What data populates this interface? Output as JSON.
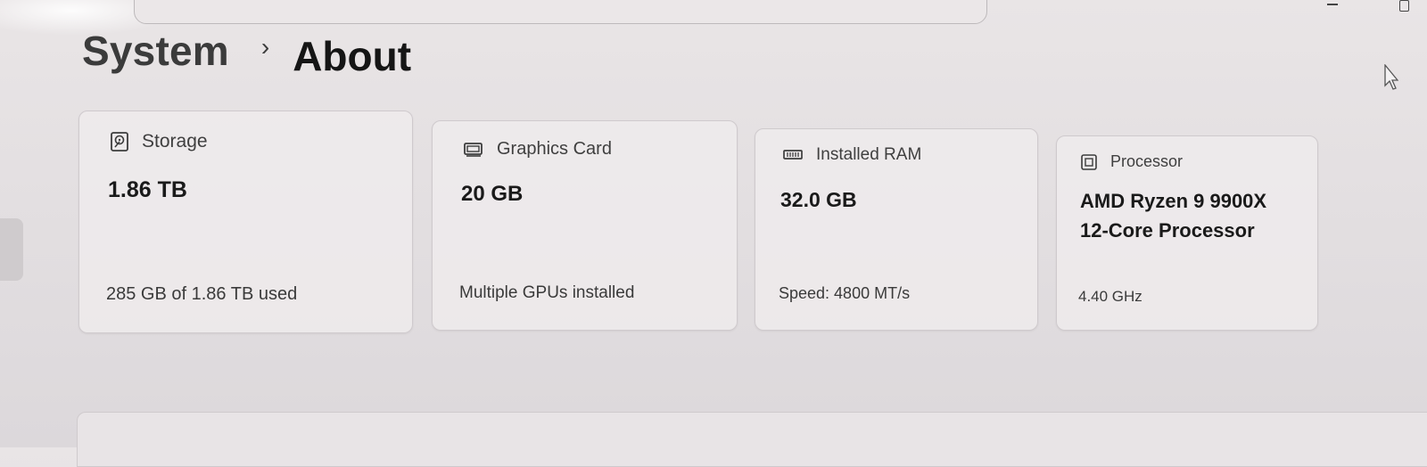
{
  "breadcrumb": {
    "parent": "System",
    "separator": "›",
    "current": "About"
  },
  "window_controls": {
    "minimize_icon": "minimize-icon",
    "maximize_icon": "maximize-icon"
  },
  "cards": {
    "storage": {
      "icon": "hard-drive-icon",
      "label": "Storage",
      "value": "1.86 TB",
      "detail": "285 GB of 1.86 TB used"
    },
    "graphics": {
      "icon": "gpu-icon",
      "label": "Graphics Card",
      "value": "20 GB",
      "detail": "Multiple GPUs installed"
    },
    "ram": {
      "icon": "memory-icon",
      "label": "Installed RAM",
      "value": "32.0 GB",
      "detail": "Speed: 4800 MT/s"
    },
    "processor": {
      "icon": "processor-icon",
      "label": "Processor",
      "value_line1": "AMD Ryzen 9 9900X",
      "value_line2": "12-Core Processor",
      "detail": "4.40 GHz"
    }
  },
  "colors": {
    "background": "#e5e1e3",
    "card": "#eeebec",
    "card_border": "#cfcacd",
    "text_primary": "#1a1a1a",
    "text_secondary": "#3a3a3a"
  }
}
